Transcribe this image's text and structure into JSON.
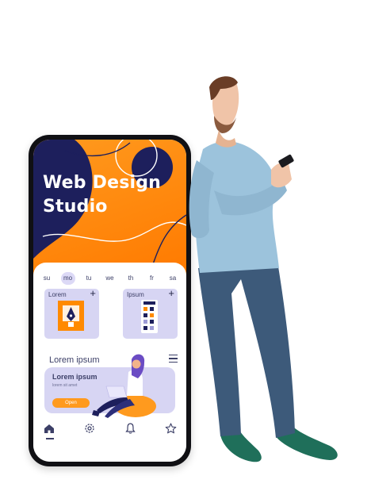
{
  "phone": {
    "hero_title_line1": "Web Design",
    "hero_title_line2": "Studio",
    "days": [
      "su",
      "mo",
      "tu",
      "we",
      "th",
      "fr",
      "sa"
    ],
    "active_day": "mo",
    "cards": [
      {
        "label": "Lorem",
        "icon": "pen-tool-icon"
      },
      {
        "label": "Ipsum",
        "icon": "color-palette-icon"
      }
    ],
    "section_title": "Lorem ipsum",
    "promo": {
      "title": "Lorem ipsum",
      "subtitle": "lorem sit amet",
      "button": "Open"
    },
    "tabs": [
      "home-icon",
      "settings-icon",
      "bell-icon",
      "star-icon"
    ]
  },
  "colors": {
    "orange": "#ff8a00",
    "navy": "#1d1f5c",
    "lavender": "#d7d5f3",
    "text": "#3c3f67"
  }
}
